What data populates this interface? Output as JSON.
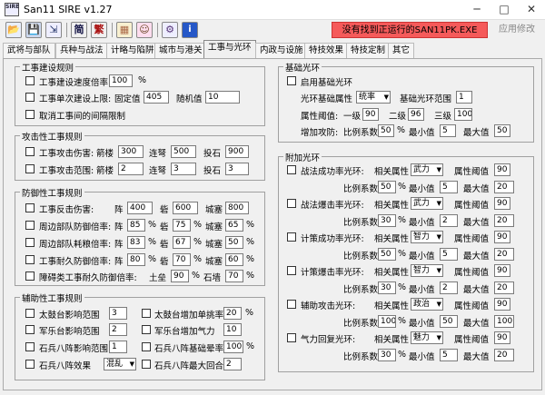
{
  "window": {
    "title": "San11 SIRE v1.27",
    "icon_text": "SIRE"
  },
  "toolbar": {
    "alert": "没有找到正运行的SAN11PK.EXE",
    "apply": "应用修改",
    "simplified": "简",
    "traditional": "繁"
  },
  "tabs": [
    "武将与部队",
    "兵种与战法",
    "计略与陷阱",
    "城市与港关",
    "工事与光环",
    "内政与设施",
    "特技效果",
    "特技定制",
    "其它"
  ],
  "build": {
    "title": "工事建设规则",
    "speed_label": "工事建设速度倍率",
    "speed_value": "100",
    "speed_unit": "%",
    "single_label": "工事单次建设上限:",
    "fixed_label": "固定值",
    "fixed_value": "405",
    "random_label": "随机值",
    "random_value": "10",
    "cancel_label": "取消工事间的间隔限制"
  },
  "attack": {
    "title": "攻击性工事规则",
    "dmg_label": "工事攻击伤害:",
    "range_label": "工事攻击范围:",
    "jianlou": "箭楼",
    "liannu": "连弩",
    "toushi": "投石",
    "dmg_values": [
      "300",
      "500",
      "900"
    ],
    "range_values": [
      "2",
      "3",
      "3"
    ]
  },
  "defense": {
    "title": "防御性工事规则",
    "rows": [
      {
        "label": "工事反击伤害:",
        "l1": "阵",
        "v1": "400",
        "l2": "砦",
        "v2": "600",
        "l3": "城塞",
        "v3": "800",
        "pct": false
      },
      {
        "label": "周边部队防御倍率:",
        "l1": "阵",
        "v1": "85",
        "l2": "砦",
        "v2": "75",
        "l3": "城塞",
        "v3": "65",
        "pct": true
      },
      {
        "label": "周边部队耗粮倍率:",
        "l1": "阵",
        "v1": "83",
        "l2": "砦",
        "v2": "67",
        "l3": "城塞",
        "v3": "50",
        "pct": true
      },
      {
        "label": "工事耐久防御倍率:",
        "l1": "阵",
        "v1": "80",
        "l2": "砦",
        "v2": "70",
        "l3": "城塞",
        "v3": "60",
        "pct": true
      }
    ],
    "last_label": "障碍类工事耐久防御倍率:",
    "tuleng": "土垒",
    "tuleng_value": "90",
    "shiqiang": "石墙",
    "shiqiang_value": "70",
    "pct": "%"
  },
  "aux": {
    "title": "辅助性工事规则",
    "left": [
      {
        "label": "太鼓台影响范围",
        "value": "3"
      },
      {
        "label": "军乐台影响范围",
        "value": "2"
      },
      {
        "label": "石兵八阵影响范围",
        "value": "1"
      },
      {
        "label": "石兵八阵效果",
        "value": "混乱",
        "select": true
      }
    ],
    "right": [
      {
        "label": "太鼓台增加单挑率",
        "value": "20",
        "unit": "%"
      },
      {
        "label": "军乐台增加气力",
        "value": "10",
        "unit": ""
      },
      {
        "label": "石兵八阵基础晕率",
        "value": "100",
        "unit": "%"
      },
      {
        "label": "石兵八阵最大回合",
        "value": "2",
        "unit": ""
      }
    ]
  },
  "halo_base": {
    "title": "基础光环",
    "enable_label": "启用基础光环",
    "attr_label": "光环基础属性",
    "attr_value": "统率",
    "range_label": "基础光环范围",
    "range_value": "1",
    "threshold_label": "属性阈值:",
    "lv1": "一级",
    "lv1_value": "90",
    "lv2": "二级",
    "lv2_value": "96",
    "lv3": "三级",
    "lv3_value": "100",
    "boost_label": "增加攻防:",
    "ratio_label": "比例系数",
    "ratio_value": "50",
    "ratio_unit": "%",
    "min_label": "最小值",
    "min_value": "5",
    "max_label": "最大值",
    "max_value": "50"
  },
  "halo_extra": {
    "title": "附加光环",
    "attr_label": "相关属性",
    "threshold_label": "属性阈值",
    "ratio_label": "比例系数",
    "min_label": "最小值",
    "max_label": "最大值",
    "rows": [
      {
        "label": "战法成功率光环:",
        "attr": "武力",
        "threshold": "90",
        "ratio": "50",
        "unit": "%",
        "min": "5",
        "max": "20"
      },
      {
        "label": "战法爆击率光环:",
        "attr": "武力",
        "threshold": "90",
        "ratio": "30",
        "unit": "%",
        "min": "2",
        "max": "20"
      },
      {
        "label": "计策成功率光环:",
        "attr": "智力",
        "threshold": "90",
        "ratio": "50",
        "unit": "%",
        "min": "5",
        "max": "20"
      },
      {
        "label": "计策爆击率光环:",
        "attr": "智力",
        "threshold": "90",
        "ratio": "30",
        "unit": "%",
        "min": "2",
        "max": "20"
      },
      {
        "label": "辅助攻击光环:",
        "attr": "政治",
        "threshold": "90",
        "ratio": "100",
        "unit": "%",
        "min": "50",
        "max": "100"
      },
      {
        "label": "气力回复光环:",
        "attr": "魅力",
        "threshold": "90",
        "ratio": "30",
        "unit": "%",
        "min": "5",
        "max": "20"
      }
    ]
  }
}
